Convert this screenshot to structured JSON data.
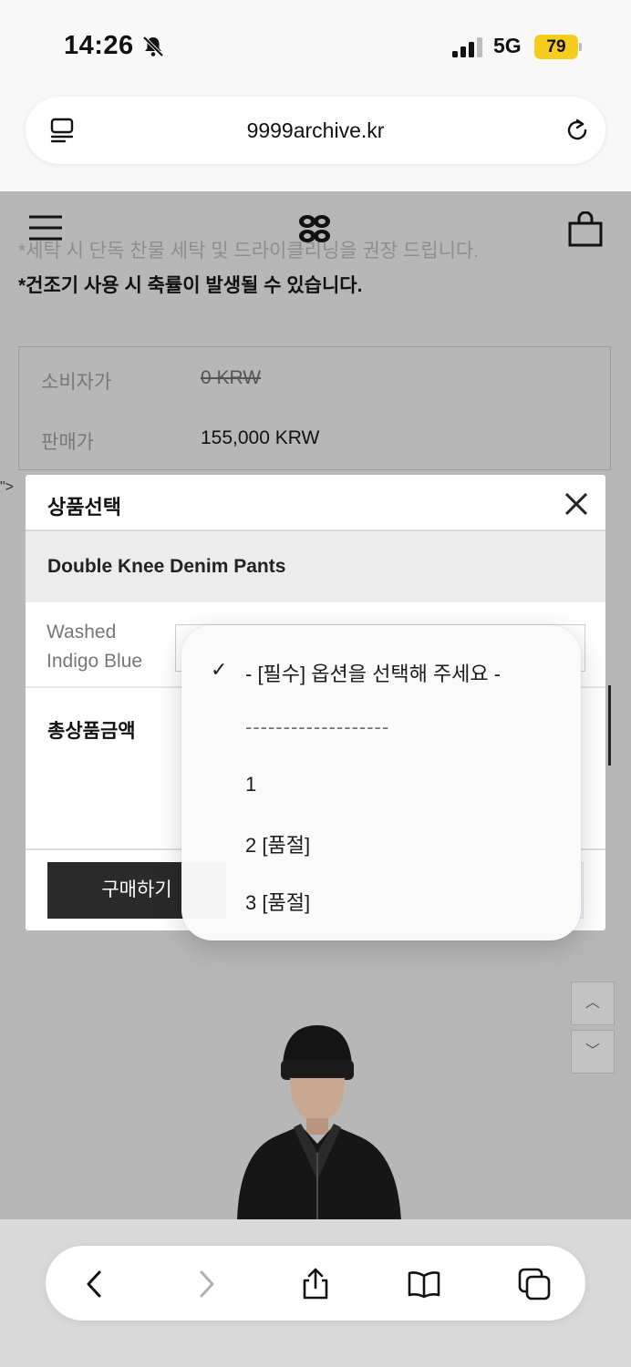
{
  "status_bar": {
    "time": "14:26",
    "network": "5G",
    "battery": "79",
    "battery_color": "#f5cd1f"
  },
  "url_bar": {
    "url": "9999archive.kr",
    "left_icon": "reader-icon",
    "right_icon": "reload-icon"
  },
  "page": {
    "care_note_1": "*세탁 시 단독 찬물 세탁 및 드라이클리닝을 권장 드립니다.",
    "care_note_2": "*건조기 사용 시 축률이 발생될 수 있습니다.",
    "stray_text": "\">",
    "prices": [
      {
        "label": "소비자가",
        "value": "0 KRW"
      },
      {
        "label": "판매가",
        "value": "155,000 KRW"
      }
    ]
  },
  "modal": {
    "title": "상품선택",
    "product_name": "Double Knee Denim Pants",
    "option_label": "Washed Indigo Blue",
    "total_label": "총상품금액",
    "buy_button": "구매하기"
  },
  "picker": {
    "selected": "- [필수] 옵션을 선택해 주세요 -",
    "separator": "-------------------",
    "options": [
      "1",
      "2 [품절]",
      "3 [품절]"
    ],
    "check_mark": "✓"
  },
  "scroll_buttons": {
    "up": "︿",
    "down": "﹀"
  }
}
